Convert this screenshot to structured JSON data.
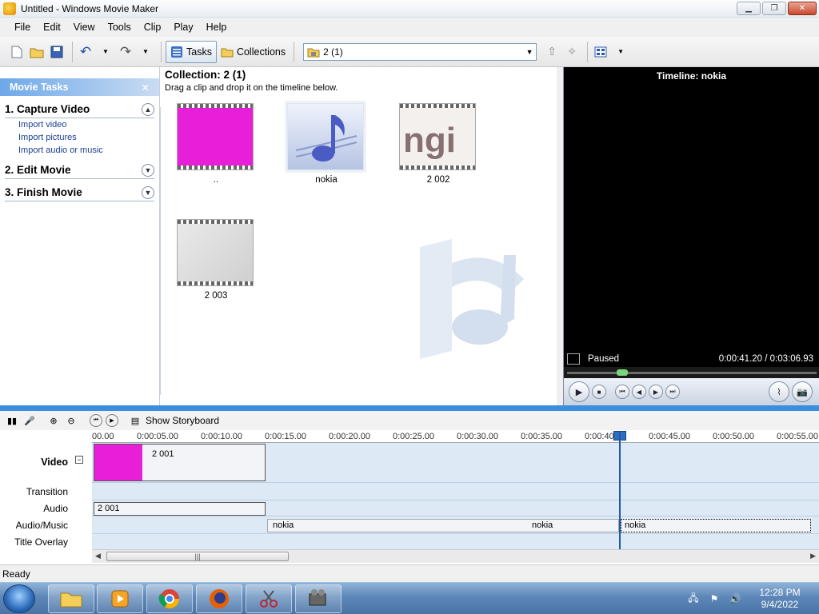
{
  "window": {
    "title": "Untitled - Windows Movie Maker"
  },
  "menu": [
    "File",
    "Edit",
    "View",
    "Tools",
    "Clip",
    "Play",
    "Help"
  ],
  "toolbar": {
    "tasks_label": "Tasks",
    "collections_label": "Collections",
    "collection_value": "2 (1)"
  },
  "tasks_pane": {
    "header": "Movie Tasks",
    "sections": [
      {
        "title": "1. Capture Video",
        "links": [
          "Import video",
          "Import pictures",
          "Import audio or music"
        ]
      },
      {
        "title": "2. Edit Movie"
      },
      {
        "title": "3. Finish Movie"
      }
    ]
  },
  "collection": {
    "title": "Collection: 2 (1)",
    "subtitle": "Drag a clip and drop it on the timeline below.",
    "clips": [
      "..",
      "nokia",
      "2 002",
      "2 003"
    ]
  },
  "preview": {
    "title": "Timeline: nokia",
    "status": "Paused",
    "time": "0:00:41.20 / 0:03:06.93",
    "progress_fraction": 0.22
  },
  "timeline": {
    "show_storyboard": "Show Storyboard",
    "ruler_ticks": [
      "00.00",
      "0:00:05.00",
      "0:00:10.00",
      "0:00:15.00",
      "0:00:20.00",
      "0:00:25.00",
      "0:00:30.00",
      "0:00:35.00",
      "0:00:40.00",
      "0:00:45.00",
      "0:00:50.00",
      "0:00:55.00"
    ],
    "tracks": {
      "video": "Video",
      "transition": "Transition",
      "audio": "Audio",
      "audio_music": "Audio/Music",
      "title_overlay": "Title Overlay"
    },
    "video_clip": "2 001",
    "audio_clip": "2 001",
    "music_clip_1": "nokia",
    "music_clip_1b": "nokia",
    "music_clip_2": "nokia"
  },
  "status": "Ready",
  "taskbar": {
    "time": "12:28 PM",
    "date": "9/4/2022"
  },
  "colors": {
    "accent": "#3a8ee0",
    "clip_magenta": "#e81fd8"
  }
}
